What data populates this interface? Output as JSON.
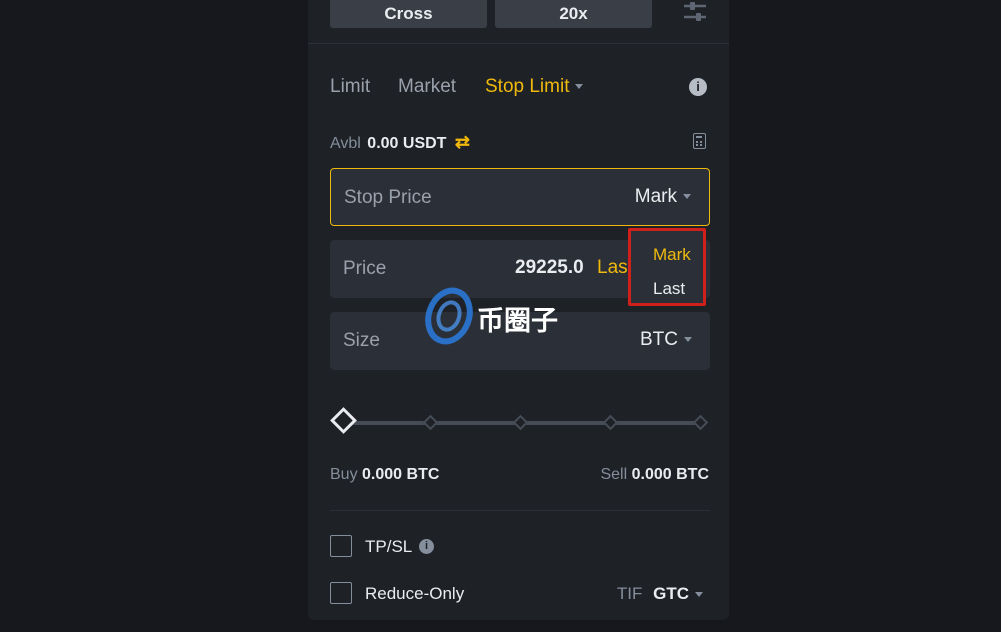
{
  "margin_mode": {
    "label": "Cross"
  },
  "leverage": {
    "label": "20x"
  },
  "order_tabs": [
    {
      "label": "Limit"
    },
    {
      "label": "Market"
    },
    {
      "label": "Stop Limit"
    }
  ],
  "available": {
    "label": "Avbl",
    "value": "0.00 USDT"
  },
  "stop_price": {
    "label": "Stop Price",
    "type": "Mark"
  },
  "price": {
    "label": "Price",
    "value": "29225.0",
    "type": "Last"
  },
  "size": {
    "label": "Size",
    "unit": "BTC"
  },
  "dropdown": {
    "options": [
      "Mark",
      "Last"
    ],
    "selected": "Mark"
  },
  "slider": {
    "level": 0
  },
  "buy": {
    "label": "Buy",
    "value": "0.000 BTC"
  },
  "sell": {
    "label": "Sell",
    "value": "0.000 BTC"
  },
  "tpsl": {
    "label": "TP/SL"
  },
  "reduce_only": {
    "label": "Reduce-Only"
  },
  "tif": {
    "label": "TIF",
    "value": "GTC"
  },
  "watermark": {
    "text": "币圈子"
  },
  "colors": {
    "accent": "#f0b90b",
    "highlight": "#d0201c",
    "panel": "#1e2126",
    "input": "#2b3038"
  }
}
